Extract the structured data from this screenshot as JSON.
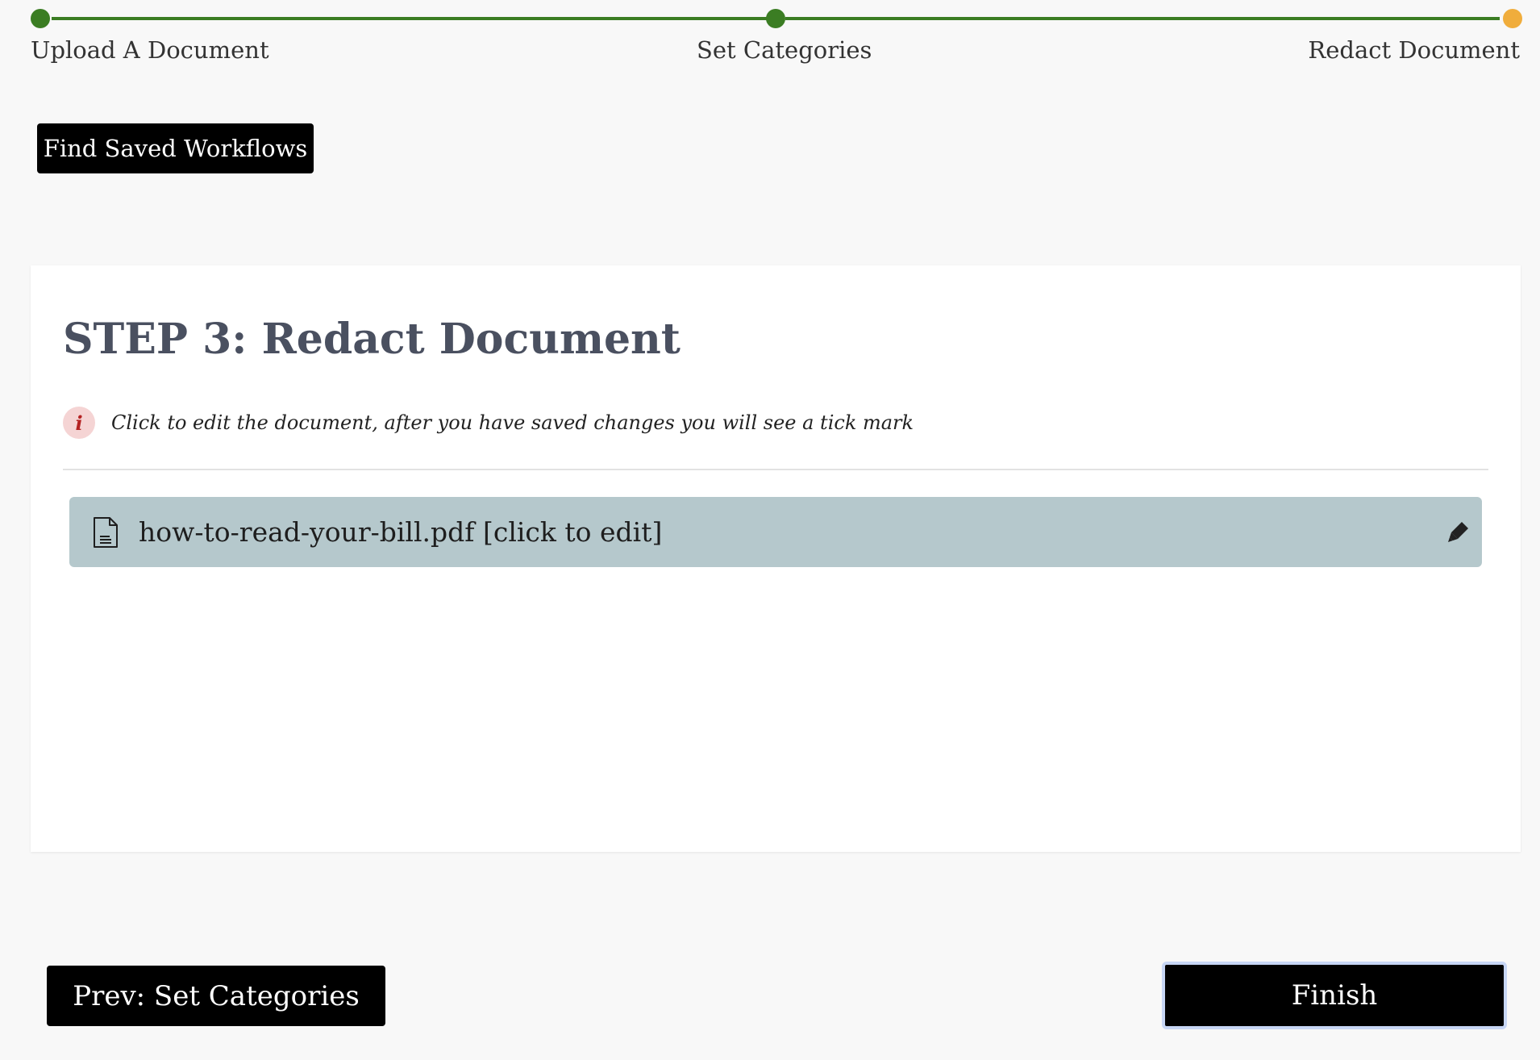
{
  "stepper": {
    "steps": [
      {
        "label": "Upload A Document",
        "status": "complete"
      },
      {
        "label": "Set Categories",
        "status": "complete"
      },
      {
        "label": "Redact Document",
        "status": "current"
      }
    ],
    "colors": {
      "complete": "#3b7d23",
      "current": "#f0ad3c"
    }
  },
  "toolbar": {
    "find_saved_workflows_label": "Find Saved Workflows"
  },
  "main": {
    "title": "STEP 3: Redact Document",
    "info_icon": "info-icon",
    "info_glyph": "i",
    "info_text": "Click to edit the document, after you have saved changes you will see a tick mark",
    "files": [
      {
        "name": "how-to-read-your-bill.pdf [click to edit]",
        "icon": "document-icon",
        "action_icon": "pen-icon"
      }
    ]
  },
  "footer": {
    "prev_label": "Prev: Set Categories",
    "finish_label": "Finish"
  }
}
